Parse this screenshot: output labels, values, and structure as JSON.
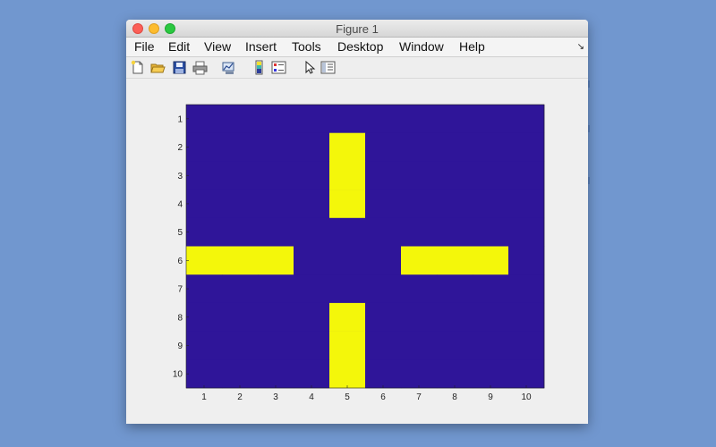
{
  "window": {
    "title": "Figure 1"
  },
  "menubar": {
    "items": [
      "File",
      "Edit",
      "View",
      "Insert",
      "Tools",
      "Desktop",
      "Window",
      "Help"
    ]
  },
  "toolbar": {
    "icons": [
      "new-figure-icon",
      "open-file-icon",
      "save-icon",
      "print-icon",
      "link-plot-icon",
      "insert-colorbar-icon",
      "insert-legend-icon",
      "edit-plot-pointer-icon",
      "show-plot-tools-icon"
    ]
  },
  "colors": {
    "background_cell": "#2f1599",
    "foreground_cell": "#f4f70a",
    "desktop": "#7197cf"
  },
  "chart_data": {
    "type": "heatmap",
    "title": "",
    "xlabel": "",
    "ylabel": "",
    "x_ticks": [
      "1",
      "2",
      "3",
      "4",
      "5",
      "6",
      "7",
      "8",
      "9",
      "10"
    ],
    "y_ticks": [
      "1",
      "2",
      "3",
      "4",
      "5",
      "6",
      "7",
      "8",
      "9",
      "10"
    ],
    "xlim": [
      0.5,
      10.5
    ],
    "ylim": [
      0.5,
      10.5
    ],
    "y_direction": "reverse",
    "grid": false,
    "values": [
      [
        0,
        0,
        0,
        0,
        0,
        0,
        0,
        0,
        0,
        0
      ],
      [
        0,
        0,
        0,
        0,
        1,
        0,
        0,
        0,
        0,
        0
      ],
      [
        0,
        0,
        0,
        0,
        1,
        0,
        0,
        0,
        0,
        0
      ],
      [
        0,
        0,
        0,
        0,
        1,
        0,
        0,
        0,
        0,
        0
      ],
      [
        0,
        0,
        0,
        0,
        0,
        0,
        0,
        0,
        0,
        0
      ],
      [
        1,
        1,
        1,
        0,
        0,
        0,
        1,
        1,
        1,
        0
      ],
      [
        0,
        0,
        0,
        0,
        0,
        0,
        0,
        0,
        0,
        0
      ],
      [
        0,
        0,
        0,
        0,
        1,
        0,
        0,
        0,
        0,
        0
      ],
      [
        0,
        0,
        0,
        0,
        1,
        0,
        0,
        0,
        0,
        0
      ],
      [
        0,
        0,
        0,
        0,
        1,
        0,
        0,
        0,
        0,
        0
      ]
    ]
  }
}
